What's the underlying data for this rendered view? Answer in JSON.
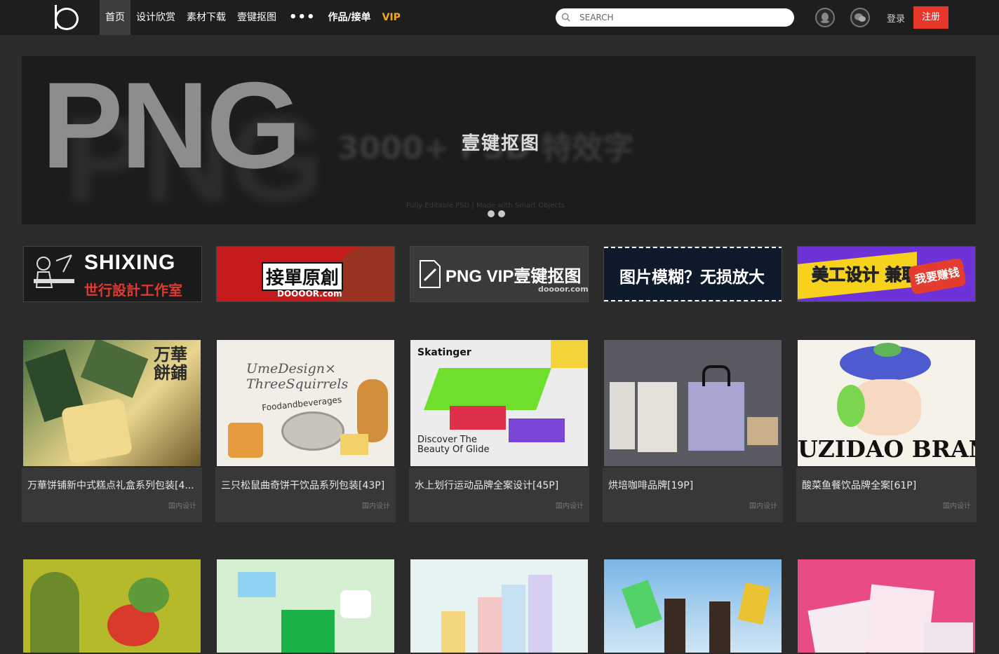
{
  "nav": {
    "items": [
      "首页",
      "设计欣赏",
      "素材下载",
      "壹键抠图"
    ],
    "more": "•••",
    "works": "作品/接单",
    "vip": "VIP"
  },
  "search": {
    "placeholder": "SEARCH"
  },
  "auth": {
    "login": "登录",
    "register": "注册"
  },
  "hero": {
    "big_text": "PNG",
    "caption": "壹键抠图",
    "blurred_text": "3000+ PSD 特效字",
    "fine_print": "Fully Editable PSD   |   Made with Smart Objects",
    "slides": 2
  },
  "ads": [
    {
      "main": "SHIXING",
      "sub": "世行設計工作室"
    },
    {
      "main": "接單原創",
      "sub": "DOOOOR.com"
    },
    {
      "main": "PNG VIP壹键抠图",
      "sub": "doooor.com"
    },
    {
      "main": "图片模糊？无损放大",
      "sub": ""
    },
    {
      "main": "美工设计 兼职接单",
      "sub": "我要赚钱"
    }
  ],
  "cards": [
    {
      "title": "万華饼铺新中式糕点礼盒系列包装[4...",
      "category": "国内设计"
    },
    {
      "title": "三只松鼠曲奇饼干饮品系列包装[43P]",
      "category": "国内设计"
    },
    {
      "title": "水上划行运动品牌全案设计[45P]",
      "category": "国内设计"
    },
    {
      "title": "烘培咖啡品牌[19P]",
      "category": "国内设计"
    },
    {
      "title": "酸菜鱼餐饮品牌全案[61P]",
      "category": "国内设计"
    }
  ],
  "thumb_text": {
    "c1": "万華 餅鋪",
    "c2a": "UmeDesign×",
    "c2b": "ThreeSquirrels",
    "c2c": "Foodandbeverages",
    "c3a": "Skatinger",
    "c3b": "Discover The Beauty Of Glide",
    "c5": "UZIDAO BRAND"
  },
  "colors": {
    "accent": "#e6372a",
    "vip": "#f5a623",
    "bg": "#2b2b2b"
  }
}
